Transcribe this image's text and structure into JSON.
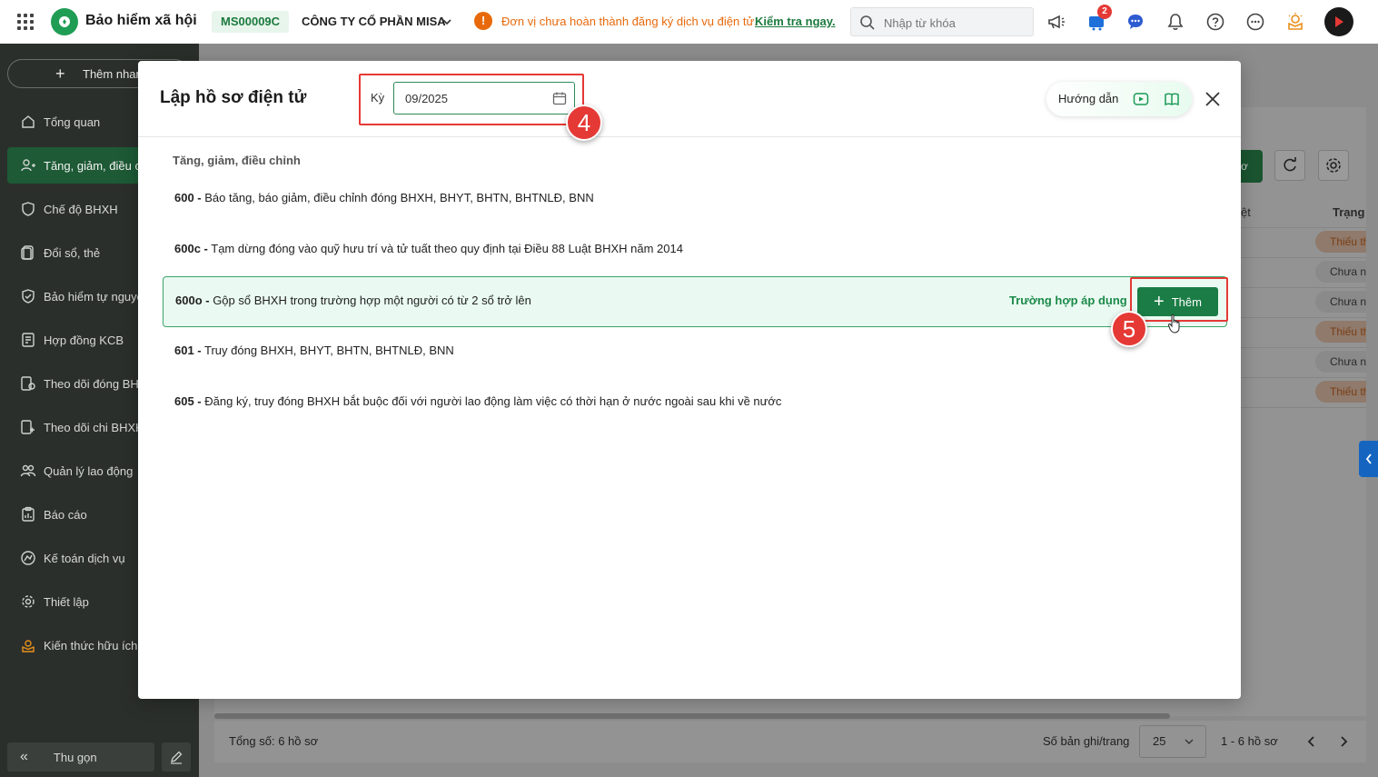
{
  "topbar": {
    "app_title": "Bảo hiểm xã hội",
    "company_code": "MS00009C",
    "company_name": "CÔNG TY CỔ PHẦN MISA",
    "warning_text": "Đơn vị chưa hoàn thành đăng ký dịch vụ điện tử.",
    "warning_link": "Kiểm tra ngay.",
    "search_placeholder": "Nhập từ khóa",
    "cart_count": "2",
    "icons": [
      "megaphone-icon",
      "cart-icon",
      "chat-icon",
      "bell-icon",
      "help-icon",
      "more-icon",
      "knowledge-icon"
    ]
  },
  "sidebar": {
    "quick_add": "Thêm nhanh",
    "items": [
      {
        "label": "Tổng quan",
        "icon": "dashboard-icon"
      },
      {
        "label": "Tăng, giảm, điều chỉnh",
        "icon": "user-change-icon",
        "active": true
      },
      {
        "label": "Chế độ BHXH",
        "icon": "shield-heart-icon"
      },
      {
        "label": "Đổi sổ, thẻ",
        "icon": "card-icon"
      },
      {
        "label": "Bảo hiểm tự nguyện",
        "icon": "shield-icon"
      },
      {
        "label": "Hợp đồng KCB",
        "icon": "contract-icon"
      },
      {
        "label": "Theo dõi đóng BHXH",
        "icon": "track-pay-icon"
      },
      {
        "label": "Theo dõi chi BHXH",
        "icon": "track-spend-icon"
      },
      {
        "label": "Quản lý lao động",
        "icon": "people-icon"
      },
      {
        "label": "Báo cáo",
        "icon": "report-icon"
      },
      {
        "label": "Kế toán dịch vụ",
        "icon": "accounting-icon"
      },
      {
        "label": "Thiết lập",
        "icon": "gear-icon"
      },
      {
        "label": "Kiến thức hữu ích",
        "icon": "knowledge-icon"
      }
    ],
    "collapse_label": "Thu gọn"
  },
  "background": {
    "green_button_fragment": "ơ",
    "col_approve_fragment": "ệt",
    "col_status": "Trạng",
    "statuses": [
      {
        "text": "Thiếu thông tin",
        "tone": "orange"
      },
      {
        "text": "Chưa nộp",
        "tone": "gray"
      },
      {
        "text": "Chưa nộp",
        "tone": "gray"
      },
      {
        "text": "Thiếu thông tin",
        "tone": "orange"
      },
      {
        "text": "Chưa nộp",
        "tone": "gray"
      },
      {
        "text": "Thiếu thông tin",
        "tone": "orange"
      }
    ],
    "total_label": "Tổng số: 6 hồ sơ",
    "per_page_label": "Số bản ghi/trang",
    "per_page_value": "25",
    "range_label": "1 - 6 hồ sơ"
  },
  "modal": {
    "title": "Lập hồ sơ điện tử",
    "period_label": "Kỳ",
    "period_value": "09/2025",
    "step_period": "4",
    "guide_label": "Hướng dẫn",
    "section_title": "Tăng, giảm, điều chỉnh",
    "forms": [
      {
        "code": "600 -",
        "desc": " Báo tăng, báo giảm, điều chỉnh đóng BHXH, BHYT, BHTN, BHTNLĐ, BNN"
      },
      {
        "code": "600c -",
        "desc": " Tạm dừng đóng vào quỹ hưu trí và tử tuất theo quy định tại Điều 88 Luật BHXH năm 2014"
      },
      {
        "code": "600o -",
        "desc": " Gộp sổ BHXH trong trường hợp một người có từ 2 sổ trở lên"
      },
      {
        "code": "601 -",
        "desc": " Truy đóng BHXH, BHYT, BHTN, BHTNLĐ, BNN"
      },
      {
        "code": "605 -",
        "desc": " Đăng ký, truy đóng BHXH bắt buộc đối với người lao động làm việc có thời hạn ở nước ngoài sau khi về nước"
      }
    ],
    "apply_link": "Trường hợp áp dụng",
    "add_button": "Thêm",
    "step_add": "5"
  },
  "colors": {
    "brand_green": "#1b7d45",
    "sidebar_bg": "#2b2f2c",
    "warning_orange": "#e8690b",
    "highlight_red": "#e53935"
  }
}
